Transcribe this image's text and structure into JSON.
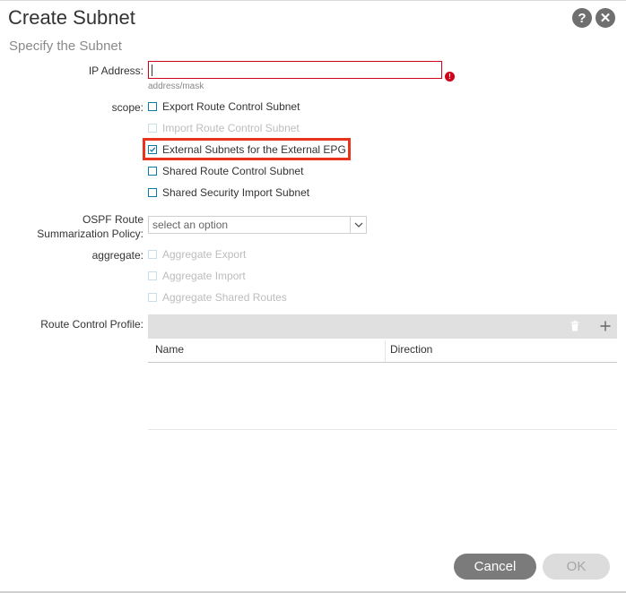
{
  "dialog": {
    "title": "Create Subnet",
    "subtitle": "Specify the Subnet",
    "help_icon": "?",
    "close_icon": "✕"
  },
  "form": {
    "ip_address": {
      "label": "IP Address:",
      "value": "",
      "hint": "address/mask",
      "error_icon": "!"
    },
    "scope": {
      "label": "scope:",
      "options": [
        {
          "label": "Export Route Control Subnet",
          "checked": false,
          "disabled": false
        },
        {
          "label": "Import Route Control Subnet",
          "checked": false,
          "disabled": true
        },
        {
          "label": "External Subnets for the External EPG",
          "checked": true,
          "disabled": false
        },
        {
          "label": "Shared Route Control Subnet",
          "checked": false,
          "disabled": false
        },
        {
          "label": "Shared Security Import Subnet",
          "checked": false,
          "disabled": false
        }
      ]
    },
    "ospf": {
      "label_line1": "OSPF Route",
      "label_line2": "Summarization Policy:",
      "placeholder": "select an option"
    },
    "aggregate": {
      "label": "aggregate:",
      "options": [
        {
          "label": "Aggregate Export",
          "checked": false,
          "disabled": true
        },
        {
          "label": "Aggregate Import",
          "checked": false,
          "disabled": true
        },
        {
          "label": "Aggregate Shared Routes",
          "checked": false,
          "disabled": true
        }
      ]
    },
    "route_control_profile": {
      "label": "Route Control Profile:",
      "columns": [
        "Name",
        "Direction"
      ]
    }
  },
  "footer": {
    "cancel_label": "Cancel",
    "ok_label": "OK"
  },
  "colors": {
    "accent": "#0a7aa6",
    "error": "#d0021b",
    "highlight": "#e8341c"
  }
}
